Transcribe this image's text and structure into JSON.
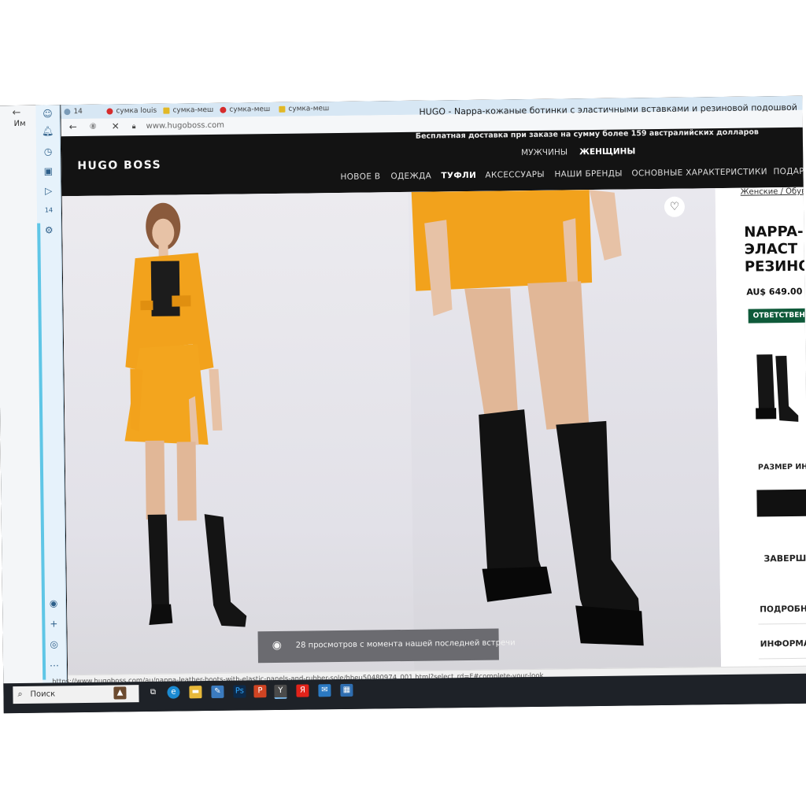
{
  "window": {
    "left_bookmarks_label": "Им"
  },
  "tabs": [
    {
      "label": "сумка louis",
      "kind": "y"
    },
    {
      "label": "сумка-меш",
      "kind": "yl"
    },
    {
      "label": "сумка-меш",
      "kind": "y"
    },
    {
      "label": "сумка-меш",
      "kind": "yl"
    }
  ],
  "tab_counter": "14",
  "address_bar": {
    "url": "www.hugoboss.com",
    "page_title": "HUGO - Nappa-кожаные ботинки с эластичными вставками и резиновой подошвой"
  },
  "site": {
    "promo": "Бесплатная доставка при заказе на сумму более 159 австралийских долларов",
    "logo": "HUGO BOSS",
    "gender_nav": [
      "МУЖЧИНЫ",
      "ЖЕНЩИНЫ"
    ],
    "main_nav": [
      "НОВОЕ В",
      "ОДЕЖДА",
      "ТУФЛИ",
      "АКСЕССУАРЫ",
      "НАШИ БРЕНДЫ",
      "ОСНОВНЫЕ ХАРАКТЕРИСТИКИ",
      "ПОДАР"
    ]
  },
  "gallery": {
    "views_text": "28 просмотров с момента нашей последней встречи"
  },
  "product": {
    "breadcrumb": "Женские / Обув",
    "title_lines": [
      "NAPPA-",
      "ЭЛАСТ",
      "РЕЗИНО"
    ],
    "price": "AU$ 649.00",
    "responsible_badge": "ОТВЕТСТВЕН",
    "size_label": "РАЗМЕР ИН",
    "complete_look": "ЗАВЕРШ",
    "details": [
      "ПОДРОБН",
      "ИНФОРМА"
    ]
  },
  "status_url": "https://www.hugoboss.com/au/nappa-leather-boots-with-elastic-panels-and-rubber-sole/hbeu50480974_001.html?select_rd=F#complete-your-look",
  "taskbar": {
    "search_label": "Поиск"
  },
  "colors": {
    "site_header": "#131313",
    "accent_side": "#5fc6e6",
    "responsible_green": "#0f5a3a",
    "outfit_orange": "#f2a21c"
  }
}
